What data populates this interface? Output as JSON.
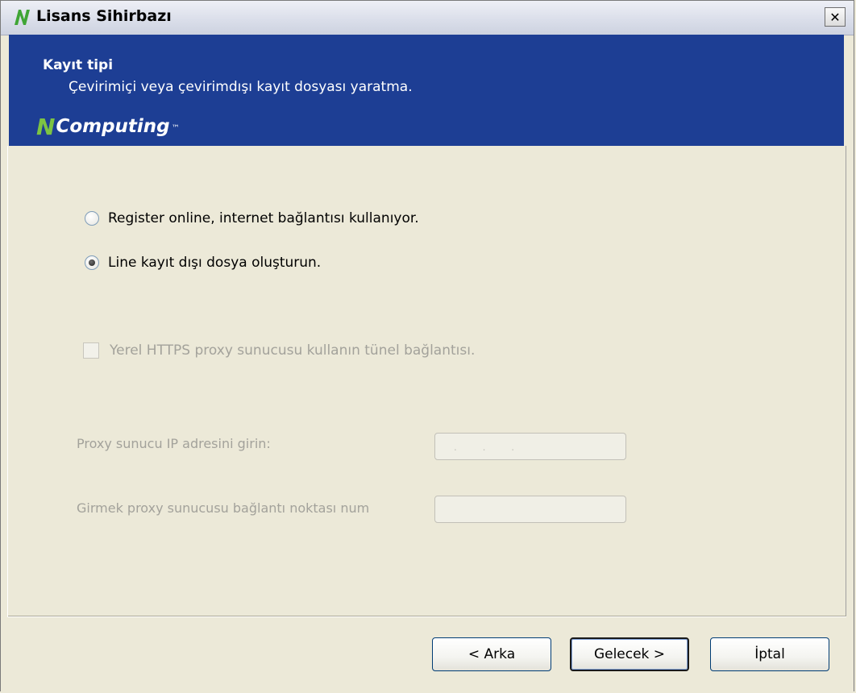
{
  "window": {
    "title": "Lisans Sihirbazı",
    "close_symbol": "✕"
  },
  "banner": {
    "title": "Kayıt tipi",
    "subtitle": "Çevirimiçi veya çevirimdışı kayıt dosyası yaratma.",
    "brand_n": "N",
    "brand_rest": "Computing",
    "brand_tm": "™",
    "colors": {
      "background": "#1d3e94",
      "brand_green": "#7dc443"
    }
  },
  "options": {
    "online_label": "Register online, internet bağlantısı kullanıyor.",
    "online_selected": false,
    "offline_label": "Line kayıt dışı dosya oluşturun.",
    "offline_selected": true
  },
  "proxy": {
    "checkbox_label": "Yerel HTTPS proxy sunucusu kullanın tünel bağlantısı.",
    "checkbox_checked": false,
    "ip_label": "Proxy sunucu IP adresini girin:",
    "ip_value": ". . .",
    "port_label": "Girmek proxy sunucusu bağlantı noktası num",
    "port_value": ""
  },
  "buttons": {
    "back": "< Arka",
    "next": "Gelecek >",
    "cancel": "İptal"
  }
}
